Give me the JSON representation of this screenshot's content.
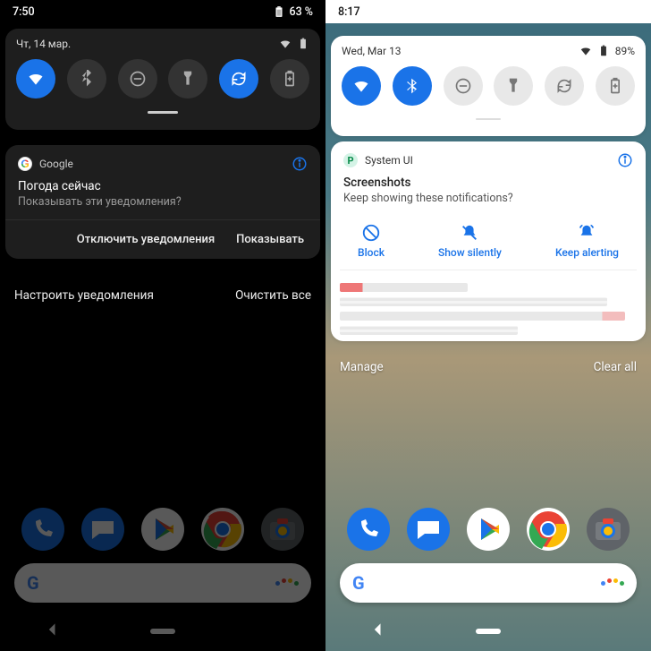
{
  "left": {
    "statusbar": {
      "time": "7:50",
      "battery": "63 %"
    },
    "qs": {
      "date": "Чт, 14 мар.",
      "tiles": [
        "wifi",
        "bluetooth",
        "dnd",
        "flashlight",
        "autorotate",
        "battery-saver"
      ],
      "active": [
        0,
        4
      ]
    },
    "notif": {
      "app_name": "Google",
      "title": "Погода сейчас",
      "body": "Показывать эти уведомления?",
      "action_block": "Отключить уведомления",
      "action_show": "Показывать"
    },
    "footer": {
      "manage": "Настроить уведомления",
      "clear": "Очистить все"
    }
  },
  "right": {
    "statusbar": {
      "time": "8:17",
      "battery": "89%"
    },
    "qs": {
      "date": "Wed, Mar 13",
      "tiles": [
        "wifi",
        "bluetooth",
        "dnd",
        "flashlight",
        "autorotate",
        "battery-saver"
      ],
      "active": [
        0,
        1
      ]
    },
    "notif": {
      "app_name": "System UI",
      "title": "Screenshots",
      "body": "Keep showing these notifications?",
      "action_block": "Block",
      "action_silent": "Show silently",
      "action_alert": "Keep alerting"
    },
    "footer": {
      "manage": "Manage",
      "clear": "Clear all"
    }
  },
  "dock_apps": [
    "phone",
    "messages",
    "play-store",
    "chrome",
    "camera"
  ]
}
